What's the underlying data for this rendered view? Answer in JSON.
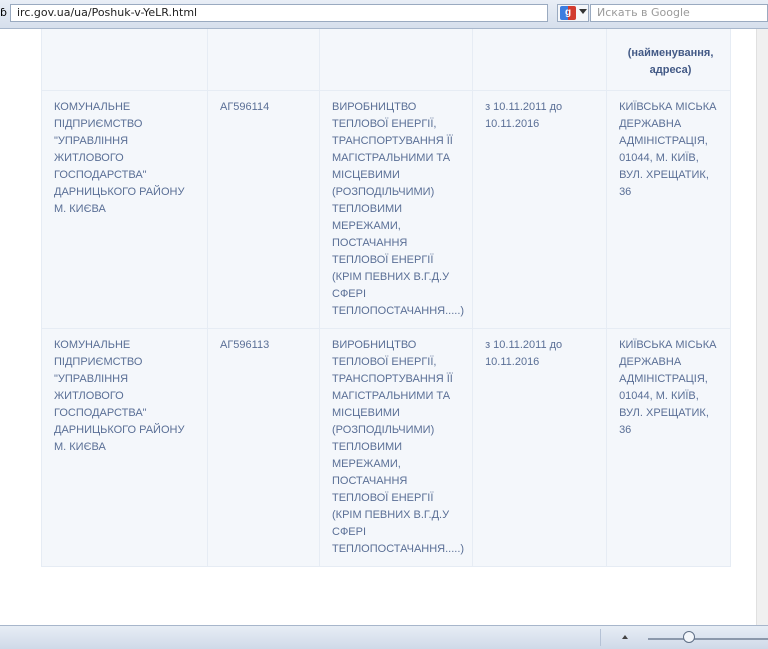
{
  "browser": {
    "tab_fragment": "ɓ",
    "url": "irc.gov.ua/ua/Poshuk-v-YeLR.html",
    "search_placeholder": "Искать в Google"
  },
  "table": {
    "partial_header": "(найменування,\nадреса)",
    "rows": [
      {
        "owner": "КОМУНАЛЬНЕ ПІДПРИЄМСТВО \"УПРАВЛІННЯ ЖИТЛОВОГО ГОСПОДАРСТВА\" ДАРНИЦЬКОГО РАЙОНУ М. КИЄВА",
        "license": "АГ596114",
        "activity": "ВИРОБНИЦТВО ТЕПЛОВОЇ ЕНЕРГІЇ, ТРАНСПОРТУВАННЯ ЇЇ МАГІСТРАЛЬНИМИ ТА МІСЦЕВИМИ (РОЗПОДІЛЬЧИМИ) ТЕПЛОВИМИ МЕРЕЖАМИ, ПОСТАЧАННЯ ТЕПЛОВОЇ ЕНЕРГІЇ (КРІМ ПЕВНИХ В.Г.Д.У СФЕРІ ТЕПЛОПОСТАЧАННЯ.....)",
        "term": "з 10.11.2011 до 10.11.2016",
        "authority": "КИЇВСЬКА МІСЬКА ДЕРЖАВНА АДМІНІСТРАЦІЯ, 01044, М. КИЇВ, ВУЛ. ХРЕЩАТИК, 36"
      },
      {
        "owner": "КОМУНАЛЬНЕ ПІДПРИЄМСТВО \"УПРАВЛІННЯ ЖИТЛОВОГО ГОСПОДАРСТВА\" ДАРНИЦЬКОГО РАЙОНУ М. КИЄВА",
        "license": "АГ596113",
        "activity": "ВИРОБНИЦТВО ТЕПЛОВОЇ ЕНЕРГІЇ, ТРАНСПОРТУВАННЯ ЇЇ МАГІСТРАЛЬНИМИ ТА МІСЦЕВИМИ (РОЗПОДІЛЬЧИМИ) ТЕПЛОВИМИ МЕРЕЖАМИ, ПОСТАЧАННЯ ТЕПЛОВОЇ ЕНЕРГІЇ (КРІМ ПЕВНИХ В.Г.Д.У СФЕРІ ТЕПЛОПОСТАЧАННЯ.....)",
        "term": "з 10.11.2011 до 10.11.2016",
        "authority": "КИЇВСЬКА МІСЬКА ДЕРЖАВНА АДМІНІСТРАЦІЯ, 01044, М. КИЇВ, ВУЛ. ХРЕЩАТИК, 36"
      }
    ]
  }
}
